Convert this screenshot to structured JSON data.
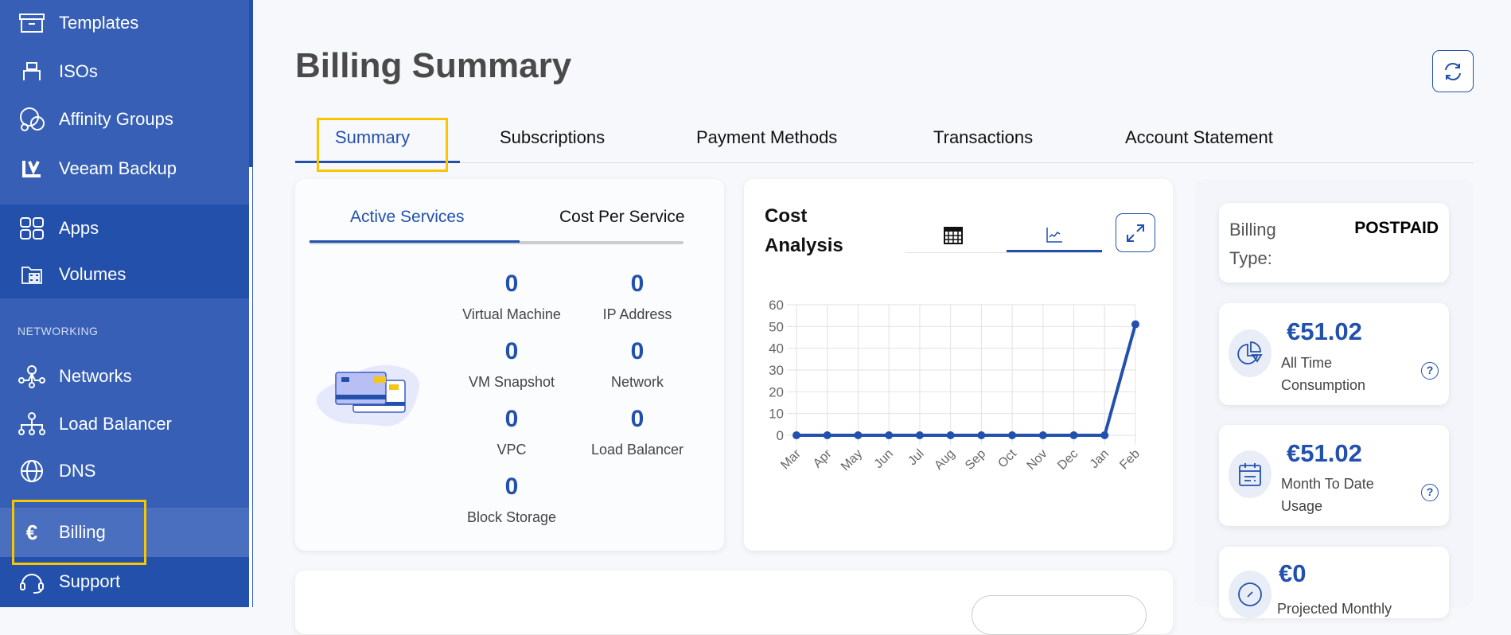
{
  "sidebar": {
    "items": [
      {
        "label": "Templates",
        "icon": "archive-icon"
      },
      {
        "label": "ISOs",
        "icon": "usb-icon"
      },
      {
        "label": "Affinity Groups",
        "icon": "affinity-icon"
      },
      {
        "label": "Veeam Backup",
        "icon": "veeam-icon"
      },
      {
        "label": "Apps",
        "icon": "apps-grid-icon"
      },
      {
        "label": "Volumes",
        "icon": "folder-grid-icon"
      },
      {
        "label": "Networks",
        "icon": "network-icon"
      },
      {
        "label": "Load Balancer",
        "icon": "sitemap-icon"
      },
      {
        "label": "DNS",
        "icon": "globe-icon"
      },
      {
        "label": "Billing",
        "icon": "euro-icon"
      },
      {
        "label": "Support",
        "icon": "headset-icon"
      }
    ],
    "section_networking": "NETWORKING"
  },
  "page": {
    "title": "Billing Summary"
  },
  "tabs": [
    "Summary",
    "Subscriptions",
    "Payment Methods",
    "Transactions",
    "Account Statement"
  ],
  "services": {
    "tabs": [
      "Active Services",
      "Cost Per Service"
    ],
    "scroll_fraction": 0.93,
    "items": [
      {
        "count": "0",
        "label": "Virtual Machine"
      },
      {
        "count": "0",
        "label": "IP Address"
      },
      {
        "count": "0",
        "label": "VM Snapshot"
      },
      {
        "count": "0",
        "label": "Network"
      },
      {
        "count": "0",
        "label": "VPC"
      },
      {
        "count": "0",
        "label": "Load Balancer"
      },
      {
        "count": "0",
        "label": "Block Storage"
      }
    ]
  },
  "cost": {
    "title_line1": "Cost",
    "title_line2": "Analysis"
  },
  "chart_data": {
    "type": "line",
    "title": "Cost Analysis",
    "categories": [
      "Mar",
      "Apr",
      "May",
      "Jun",
      "Jul",
      "Aug",
      "Sep",
      "Oct",
      "Nov",
      "Dec",
      "Jan",
      "Feb"
    ],
    "values": [
      0,
      0,
      0,
      0,
      0,
      0,
      0,
      0,
      0,
      0,
      0,
      51.02
    ],
    "yticks": [
      "0",
      "10",
      "20",
      "30",
      "40",
      "50",
      "60"
    ],
    "ylim": [
      0,
      60
    ],
    "grid": true,
    "color": "#2251ad"
  },
  "summary": {
    "billing_type_label_1": "Billing",
    "billing_type_label_2": "Type:",
    "billing_type": "POSTPAID",
    "cards": [
      {
        "amount": "€51.02",
        "label": "All Time Consumption"
      },
      {
        "amount": "€51.02",
        "label": "Month To Date Usage"
      },
      {
        "amount": "€0",
        "label": "Projected Monthly"
      }
    ],
    "help": "?"
  }
}
